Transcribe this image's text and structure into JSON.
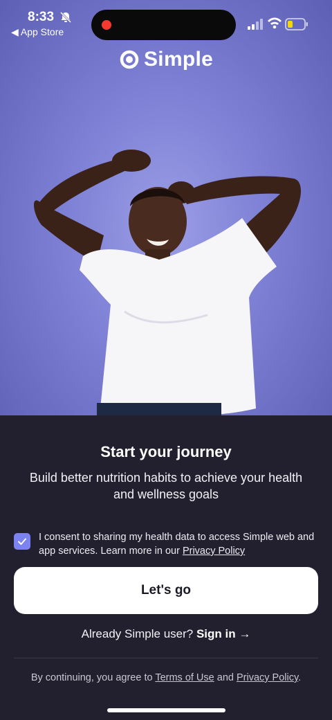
{
  "status_bar": {
    "time": "8:33",
    "back_label": "◀ App Store"
  },
  "brand": {
    "name": "Simple"
  },
  "onboarding": {
    "title": "Start your journey",
    "subtitle": "Build better nutrition habits to achieve your health and wellness goals",
    "consent": {
      "checked": true,
      "text": "I consent to sharing my health data to access Simple web and app services. Learn more in our ",
      "link": "Privacy Policy"
    },
    "cta_label": "Let's go",
    "signin_prompt": "Already Simple user? ",
    "signin_link": "Sign in →",
    "legal": {
      "prefix": "By continuing, you agree to ",
      "terms_link": "Terms of Use",
      "conjunction": " and ",
      "privacy_link": "Privacy Policy",
      "suffix": "."
    }
  },
  "colors": {
    "hero_background": "#8a8ddd",
    "sheet_background": "#22202f",
    "checkbox_accent": "#7c82ef",
    "cta_background": "#ffffff",
    "recording_dot": "#f23a2e",
    "battery_level": "#f5d800"
  },
  "icons": {
    "bell": "bell-slash-icon",
    "signal": "cellular-signal-icon",
    "wifi": "wifi-icon",
    "battery": "battery-low-icon",
    "checkbox": "checkmark-icon",
    "logo": "simple-logo-ring-icon"
  }
}
